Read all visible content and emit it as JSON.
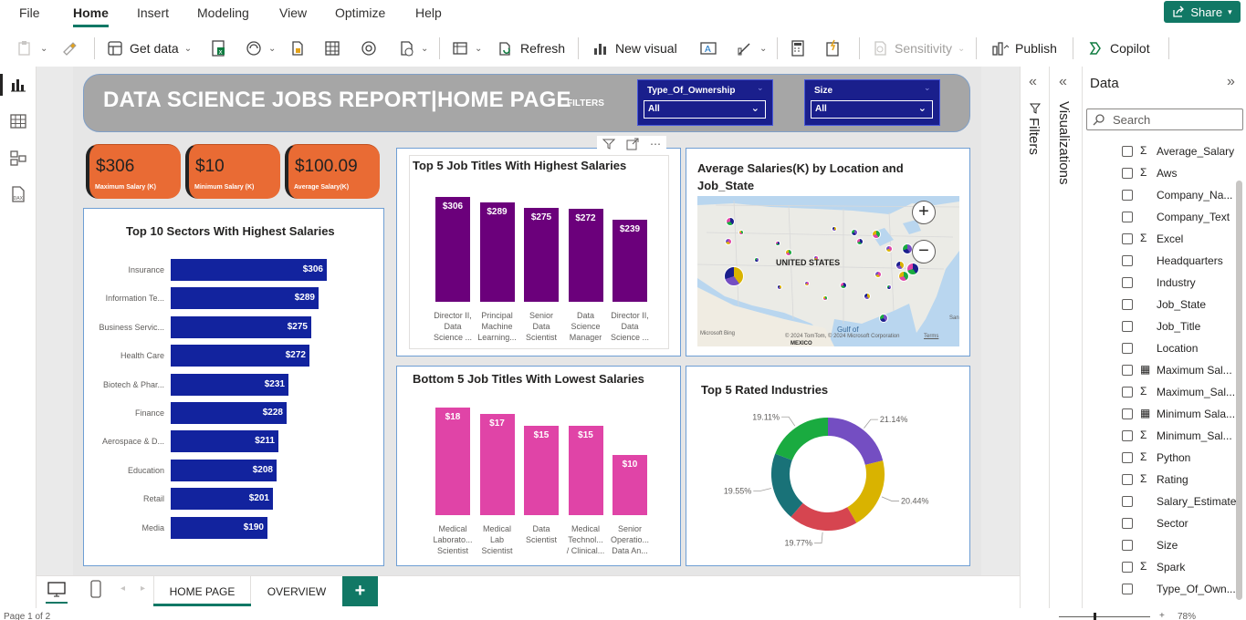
{
  "menu": {
    "file": "File",
    "home": "Home",
    "insert": "Insert",
    "modeling": "Modeling",
    "view": "View",
    "optimize": "Optimize",
    "help": "Help",
    "share": "Share"
  },
  "ribbon": {
    "get_data": "Get data",
    "refresh": "Refresh",
    "new_visual": "New visual",
    "sensitivity": "Sensitivity",
    "publish": "Publish",
    "copilot": "Copilot"
  },
  "report": {
    "title": "DATA SCIENCE JOBS REPORT|HOME PAGE",
    "filters_label": "FILTERS"
  },
  "slicers": [
    {
      "title": "Type_Of_Ownership",
      "value": "All"
    },
    {
      "title": "Size",
      "value": "All"
    }
  ],
  "kpis": [
    {
      "value": "$306",
      "label": "Maximum Salary (K)"
    },
    {
      "value": "$10",
      "label": "Minimum Salary (K)"
    },
    {
      "value": "$100.09",
      "label": "Average Salary(K)"
    }
  ],
  "chart_data": [
    {
      "type": "bar",
      "orientation": "horizontal",
      "title": "Top 10 Sectors With Highest Salaries",
      "categories": [
        "Insurance",
        "Information Te...",
        "Business Servic...",
        "Health Care",
        "Biotech & Phar...",
        "Finance",
        "Aerospace & D...",
        "Education",
        "Retail",
        "Media"
      ],
      "values": [
        306,
        289,
        275,
        272,
        231,
        228,
        211,
        208,
        201,
        190
      ],
      "labels": [
        "$306",
        "$289",
        "$275",
        "$272",
        "$231",
        "$228",
        "$211",
        "$208",
        "$201",
        "$190"
      ],
      "color": "#12239e"
    },
    {
      "type": "bar",
      "title": "Top 5 Job Titles With Highest Salaries",
      "categories": [
        [
          "Director II,",
          "Data",
          "Science ..."
        ],
        [
          "Principal",
          "Machine",
          "Learning..."
        ],
        [
          "Senior",
          "Data",
          "Scientist"
        ],
        [
          "Data",
          "Science",
          "Manager"
        ],
        [
          "Director II,",
          "Data",
          "Science ..."
        ]
      ],
      "values": [
        306,
        289,
        275,
        272,
        239
      ],
      "labels": [
        "$306",
        "$289",
        "$275",
        "$272",
        "$239"
      ],
      "color": "#6b007b"
    },
    {
      "type": "bar",
      "title": "Bottom 5 Job Titles With Lowest Salaries",
      "categories": [
        [
          "Medical",
          "Laborato...",
          "Scientist"
        ],
        [
          "Medical",
          "Lab",
          "Scientist"
        ],
        [
          "Data",
          "Scientist",
          ""
        ],
        [
          "Medical",
          "Technol...",
          "/ Clinical..."
        ],
        [
          "Senior",
          "Operatio...",
          "Data An..."
        ]
      ],
      "values": [
        18,
        17,
        15,
        15,
        10
      ],
      "labels": [
        "$18",
        "$17",
        "$15",
        "$15",
        "$10"
      ],
      "color": "#e044a7"
    },
    {
      "type": "pie",
      "style": "donut",
      "title": "Top 5 Rated Industries",
      "values": [
        21.14,
        20.44,
        19.77,
        19.55,
        19.11
      ],
      "labels": [
        "21.14%",
        "20.44%",
        "19.77%",
        "19.55%",
        "19.11%"
      ],
      "colors": [
        "#744ec2",
        "#d9b300",
        "#d64550",
        "#197278",
        "#1aab40"
      ]
    }
  ],
  "map": {
    "title": "Average Salaries(K) by Location and Job_State",
    "country_label": "UNITED STATES",
    "gulf_label": "Gulf of",
    "mexico_label": "MEXICO",
    "attribution": "© 2024 TomTom, © 2024 Microsoft Corporation",
    "terms": "Terms",
    "bing": "Microsoft Bing",
    "san_label": "San"
  },
  "panes": {
    "filters": "Filters",
    "visualizations": "Visualizations",
    "data": "Data",
    "search_placeholder": "Search"
  },
  "fields": [
    {
      "name": "Average_Salary",
      "sym": "Σ"
    },
    {
      "name": "Aws",
      "sym": "Σ"
    },
    {
      "name": "Company_Na...",
      "sym": ""
    },
    {
      "name": "Company_Text",
      "sym": ""
    },
    {
      "name": "Excel",
      "sym": "Σ"
    },
    {
      "name": "Headquarters",
      "sym": ""
    },
    {
      "name": "Industry",
      "sym": ""
    },
    {
      "name": "Job_State",
      "sym": ""
    },
    {
      "name": "Job_Title",
      "sym": ""
    },
    {
      "name": "Location",
      "sym": ""
    },
    {
      "name": "Maximum Sal...",
      "sym": "▦"
    },
    {
      "name": "Maximum_Sal...",
      "sym": "Σ"
    },
    {
      "name": "Minimum Sala...",
      "sym": "▦"
    },
    {
      "name": "Minimum_Sal...",
      "sym": "Σ"
    },
    {
      "name": "Python",
      "sym": "Σ"
    },
    {
      "name": "Rating",
      "sym": "Σ"
    },
    {
      "name": "Salary_Estimate",
      "sym": ""
    },
    {
      "name": "Sector",
      "sym": ""
    },
    {
      "name": "Size",
      "sym": ""
    },
    {
      "name": "Spark",
      "sym": "Σ"
    },
    {
      "name": "Type_Of_Own...",
      "sym": ""
    }
  ],
  "tabs": [
    {
      "label": "HOME PAGE"
    },
    {
      "label": "OVERVIEW"
    }
  ],
  "add_tab": "+",
  "status": {
    "page": "Page 1 of 2",
    "zoom": "78%"
  }
}
